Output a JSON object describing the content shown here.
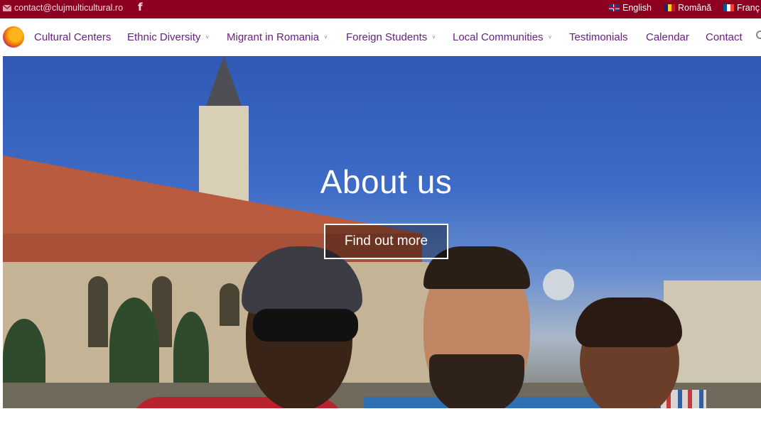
{
  "topbar": {
    "email": "contact@clujmulticultural.ro",
    "facebook_icon": "f",
    "languages": [
      {
        "label": "English",
        "flag": "uk-flag-icon"
      },
      {
        "label": "Română",
        "flag": "romania-flag-icon"
      },
      {
        "label": "Franç",
        "flag": "france-flag-icon"
      }
    ]
  },
  "nav": {
    "items": [
      {
        "label": "Cultural Centers",
        "has_dropdown": false
      },
      {
        "label": "Ethnic Diversity",
        "has_dropdown": true
      },
      {
        "label": "Migrant in Romania",
        "has_dropdown": true
      },
      {
        "label": "Foreign Students",
        "has_dropdown": true
      },
      {
        "label": "Local Communities",
        "has_dropdown": true
      },
      {
        "label": "Testimonials",
        "has_dropdown": false
      },
      {
        "label": "Calendar",
        "has_dropdown": false
      },
      {
        "label": "Contact",
        "has_dropdown": false
      }
    ],
    "chevron": "˅"
  },
  "hero": {
    "title": "About us",
    "button_label": "Find out more"
  },
  "colors": {
    "topbar": "#8d0020",
    "nav_text": "#6a1f85",
    "sky": "#2f59b4"
  }
}
